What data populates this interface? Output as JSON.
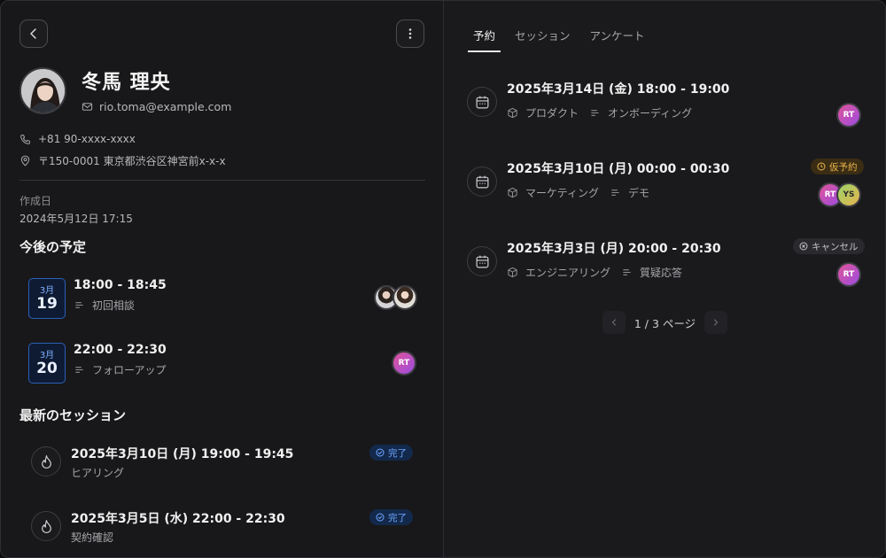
{
  "colors": {
    "accent": "#2a5fb8",
    "done": "#6fa6ff",
    "tentative": "#e9b44c",
    "cancel": "#c4c4c8"
  },
  "profile": {
    "name": "冬馬 理央",
    "email": "rio.toma@example.com",
    "phone": "+81 90-xxxx-xxxx",
    "address": "〒150-0001 東京都渋谷区神宮前x-x-x",
    "created_label": "作成日",
    "created_value": "2024年5月12日 17:15"
  },
  "upcoming": {
    "title": "今後の予定",
    "items": [
      {
        "month": "3月",
        "day": "19",
        "time": "18:00 - 18:45",
        "label": "初回相談"
      },
      {
        "month": "3月",
        "day": "20",
        "time": "22:00 - 22:30",
        "label": "フォローアップ",
        "avatar": "RT"
      }
    ]
  },
  "sessions": {
    "title": "最新のセッション",
    "items": [
      {
        "title": "2025年3月10日 (月) 19:00 - 19:45",
        "label": "ヒアリング",
        "status": "完了"
      },
      {
        "title": "2025年3月5日 (水) 22:00 - 22:30",
        "label": "契約確認",
        "status": "完了"
      }
    ]
  },
  "tabs": [
    "予約",
    "セッション",
    "アンケート"
  ],
  "bookings": [
    {
      "title": "2025年3月14日 (金) 18:00 - 19:00",
      "product": "プロダクト",
      "type": "オンボーディング",
      "avatars": [
        "RT"
      ]
    },
    {
      "title": "2025年3月10日 (月) 00:00 - 00:30",
      "product": "マーケティング",
      "type": "デモ",
      "status": "仮予約",
      "avatars": [
        "RT",
        "YS"
      ]
    },
    {
      "title": "2025年3月3日 (月) 20:00 - 20:30",
      "product": "エンジニアリング",
      "type": "質疑応答",
      "status": "キャンセル",
      "avatars": [
        "RT"
      ]
    }
  ],
  "pagination": {
    "text": "1 / 3 ページ"
  },
  "icons": {
    "back": "chevron-left-icon",
    "more": "more-vertical-icon",
    "mail": "mail-icon",
    "phone": "phone-icon",
    "location": "map-pin-icon",
    "list": "list-icon",
    "flame": "flame-icon",
    "calendar": "calendar-icon",
    "box": "box-icon"
  }
}
